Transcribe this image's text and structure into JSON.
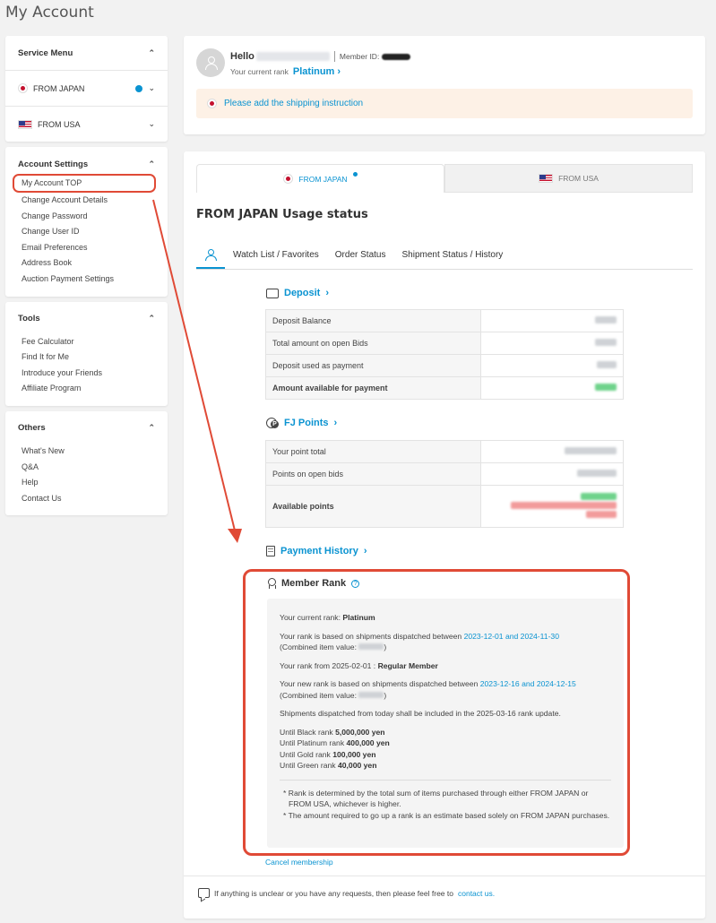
{
  "page": {
    "title": "My Account"
  },
  "sidebar": {
    "service_menu": {
      "title": "Service Menu",
      "items": [
        {
          "label": "FROM JAPAN"
        },
        {
          "label": "FROM USA"
        }
      ]
    },
    "account_settings": {
      "title": "Account Settings",
      "links": [
        "My Account TOP",
        "Change Account Details",
        "Change Password",
        "Change User ID",
        "Email Preferences",
        "Address Book",
        "Auction Payment Settings"
      ]
    },
    "tools": {
      "title": "Tools",
      "links": [
        "Fee Calculator",
        "Find It for Me",
        "Introduce your Friends",
        "Affiliate Program"
      ]
    },
    "others": {
      "title": "Others",
      "links": [
        "What's New",
        "Q&A",
        "Help",
        "Contact Us"
      ]
    }
  },
  "header": {
    "hello": "Hello",
    "member_id_label": "Member ID:",
    "rank_label": "Your current rank",
    "rank_value": "Platinum",
    "notice": "Please add the shipping instruction"
  },
  "usage": {
    "tabs": [
      "FROM JAPAN",
      "FROM USA"
    ],
    "title": "FROM JAPAN Usage status",
    "sub_tabs": [
      "Watch List / Favorites",
      "Order Status",
      "Shipment Status / History"
    ],
    "deposit": {
      "title": "Deposit",
      "rows": [
        "Deposit Balance",
        "Total amount on open Bids",
        "Deposit used as payment",
        "Amount available for payment"
      ]
    },
    "points": {
      "title": "FJ Points",
      "rows": [
        "Your point total",
        "Points on open bids",
        "Available points"
      ]
    },
    "payment_history": "Payment History",
    "member_rank": {
      "title": "Member Rank",
      "current_label": "Your current rank:",
      "current_value": "Platinum",
      "based_prefix": "Your rank is based on shipments dispatched between",
      "based_range": "2023-12-01 and 2024-11-30",
      "combined_label": "(Combined item value:",
      "new_rank_prefix": "Your rank from 2025-02-01 :",
      "new_rank_value": "Regular Member",
      "new_based_prefix": "Your new rank is based on shipments dispatched between",
      "new_based_range": "2023-12-16 and 2024-12-15",
      "update_note": "Shipments dispatched from today shall be included in the 2025-03-16 rank update.",
      "until": [
        {
          "label": "Until Black rank",
          "value": "5,000,000 yen"
        },
        {
          "label": "Until Platinum rank",
          "value": "400,000 yen"
        },
        {
          "label": "Until Gold rank",
          "value": "100,000 yen"
        },
        {
          "label": "Until Green rank",
          "value": "40,000 yen"
        }
      ],
      "note1": "* Rank is determined by the total sum of items purchased through either FROM JAPAN or FROM USA, whichever is higher.",
      "note2": "* The amount required to go up a rank is an estimate based solely on FROM JAPAN purchases."
    },
    "cancel": "Cancel membership",
    "footer_text": "If anything is unclear or you have any requests, then please feel free to",
    "footer_link": "contact us."
  },
  "colors": {
    "accent": "#0a93d1",
    "highlight": "#e04a36",
    "notice_bg": "#fdf1e6"
  }
}
